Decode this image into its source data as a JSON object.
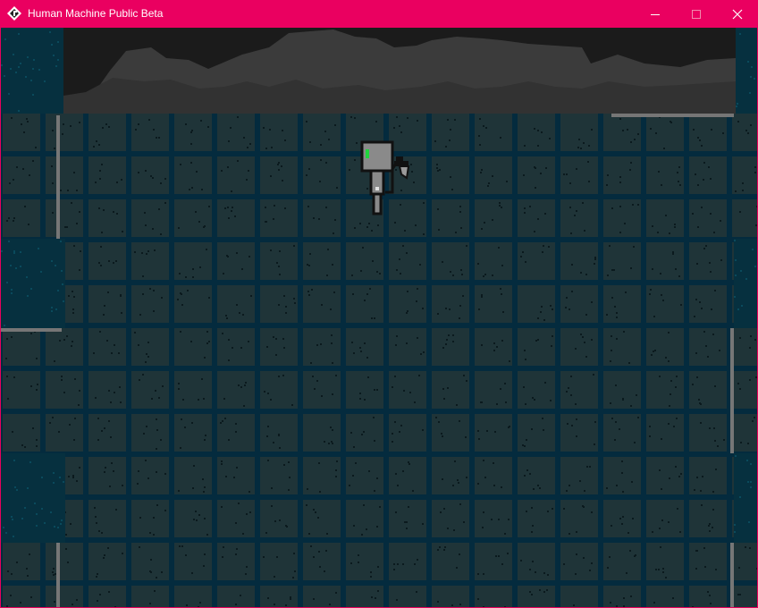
{
  "window": {
    "title": "Human Machine Public Beta",
    "buttons": {
      "minimize": "minimize-icon",
      "maximize": "maximize-icon",
      "close": "close-icon"
    },
    "colors": {
      "titlebar": "#ea0060",
      "title_text": "#ffffff"
    }
  },
  "game": {
    "colors": {
      "backdrop_sky": "#1b1b1b",
      "backdrop_hills": "#3b3b3b",
      "tile": "#1f3438",
      "grout": "#042b3e",
      "rivet": "#0b1a1e",
      "pillar": "#06303f",
      "pipe": "#767676",
      "robot_body": "#8a8a8a",
      "robot_outline": "#111111",
      "robot_eye": "#21d33d"
    },
    "entities": [
      "player-robot",
      "handheld-weapon"
    ]
  }
}
